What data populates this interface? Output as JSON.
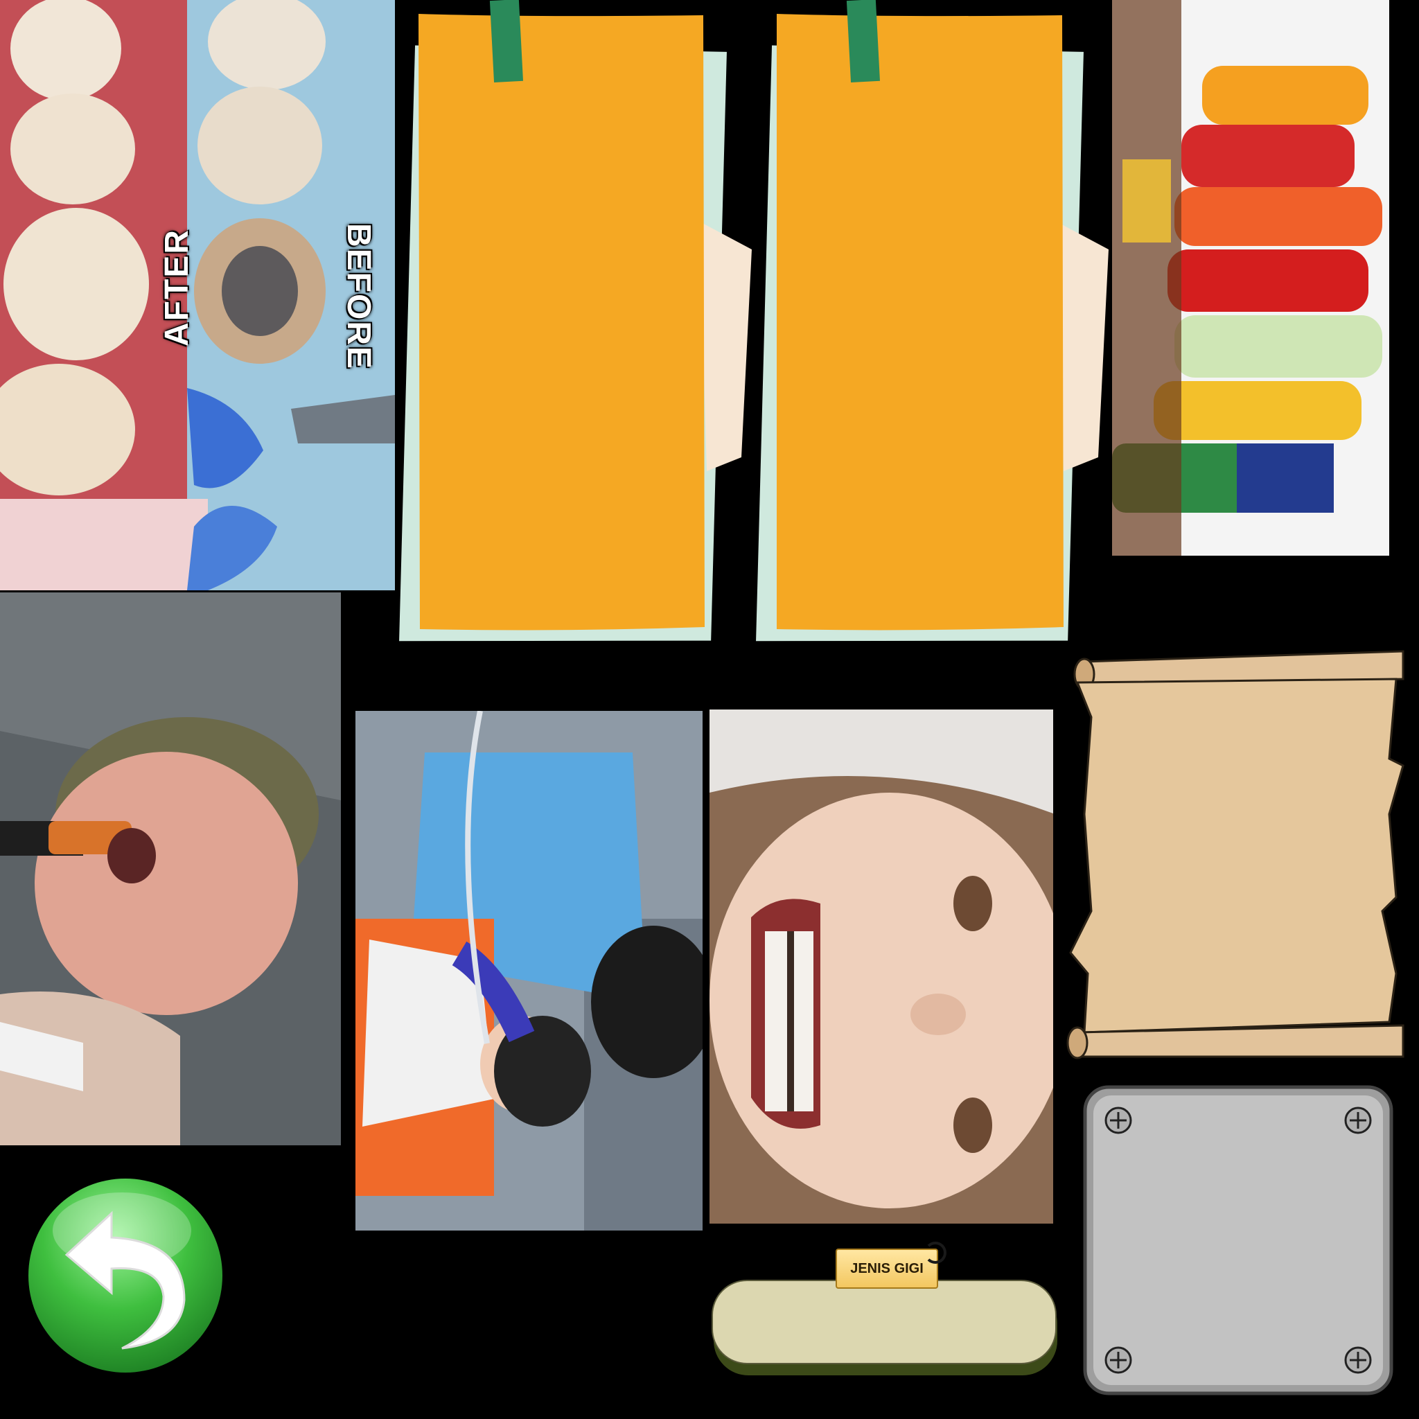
{
  "photo_dental": {
    "label_after": "AFTER",
    "label_before": "BEFORE"
  },
  "name_box": {
    "label": "JENIS GIGI",
    "value": ""
  },
  "back_button": {
    "icon": "undo-arrow-icon"
  },
  "colors": {
    "sticky_note": "#f5a823",
    "tape": "#2a8a5a",
    "button_green": "#3fbf3f",
    "scroll_paper": "#e7c9a0",
    "metal_plate": "#b7b7b7"
  }
}
